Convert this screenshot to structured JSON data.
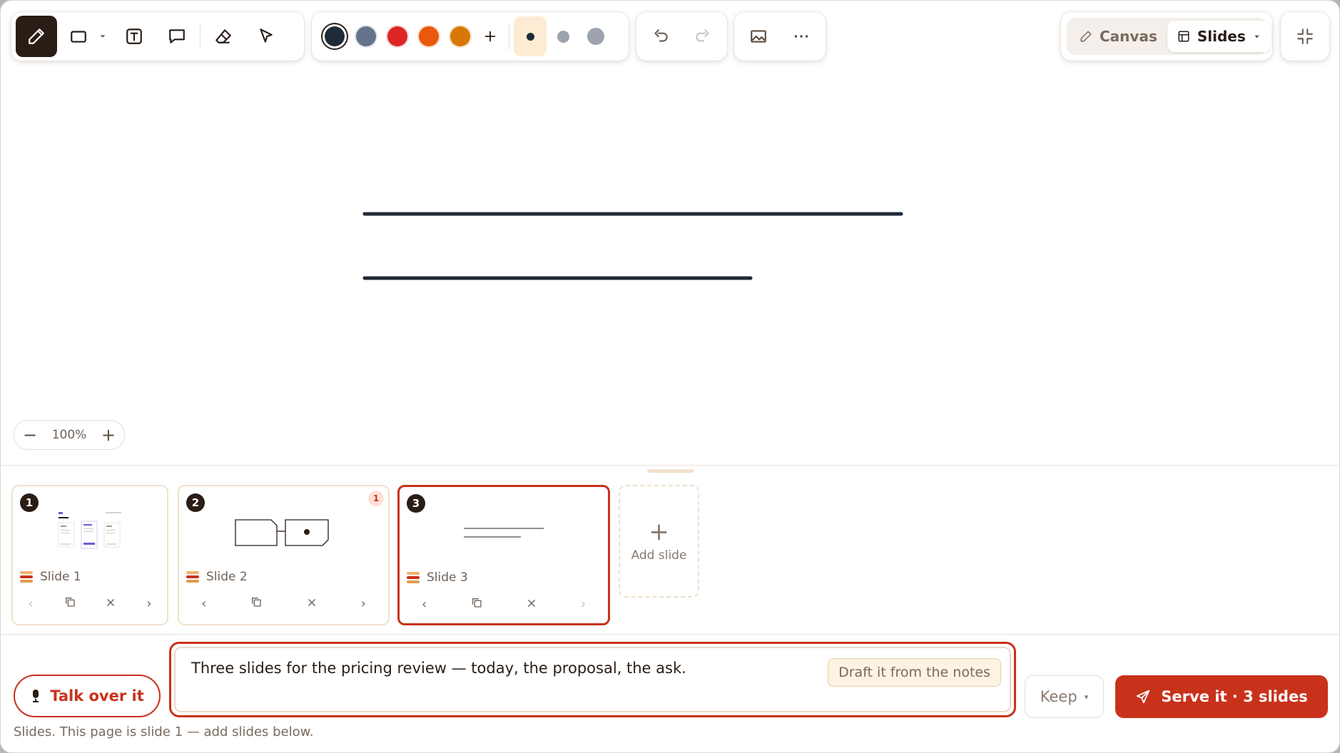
{
  "toolbar": {
    "tools": [
      {
        "name": "pen-icon",
        "active": true
      },
      {
        "name": "rectangle-icon"
      },
      {
        "name": "dropdown-caret-icon"
      },
      {
        "name": "text-tool-icon"
      },
      {
        "name": "comment-icon"
      },
      {
        "name": "eraser-icon"
      },
      {
        "name": "pointer-icon"
      }
    ],
    "colors": [
      "#1f2a37",
      "#64748b",
      "#dc2626",
      "#ea580c",
      "#d97706"
    ],
    "selected_color": "#1f2a37",
    "add_color_icon": "plus-icon",
    "stroke_sizes": [
      "small",
      "medium",
      "large"
    ],
    "selected_stroke": "small",
    "undo_icon": "undo-icon",
    "redo_icon": "redo-icon",
    "image_icon": "image-icon",
    "more_icon": "more-icon"
  },
  "mode_switch": {
    "canvas_label": "Canvas",
    "slides_label": "Slides",
    "active": "Slides"
  },
  "collapse_icon": "collapse-icon",
  "zoom": {
    "minus": "−",
    "level": "100%",
    "plus": "+"
  },
  "slides": [
    {
      "number": "1",
      "label": "Slide 1",
      "badge": "",
      "active": false
    },
    {
      "number": "2",
      "label": "Slide 2",
      "badge": "1",
      "active": false
    },
    {
      "number": "3",
      "label": "Slide 3",
      "badge": "",
      "active": true
    }
  ],
  "add_slide": {
    "icon": "+",
    "label": "Add slide"
  },
  "composer": {
    "talk_label": "Talk over it",
    "prompt_text": "Three slides for the pricing review — today, the proposal, the ask.",
    "draft_label": "Draft it from the notes",
    "keep_label": "Keep",
    "serve_label": "Serve it · 3 slides",
    "status": "Slides. This page is slide 1 — add slides below."
  },
  "colors": {
    "accent": "#c8321b",
    "ink": "#2a1d15",
    "cream": "#fdf3e3"
  }
}
